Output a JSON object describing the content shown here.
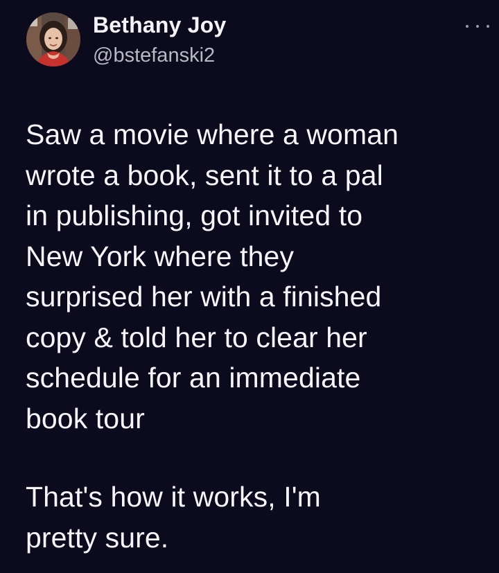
{
  "tweet": {
    "author": {
      "display_name": "Bethany Joy",
      "handle": "@bstefanski2",
      "avatar_icon": "profile-photo"
    },
    "more_icon": "more-horizontal-icon",
    "paragraphs": [
      "Saw a movie where a woman\nwrote a book, sent it to a pal\nin publishing, got invited to\nNew York where they\nsurprised her with a finished\ncopy & told her to clear her\nschedule for an immediate\nbook tour",
      "That's how it works, I'm\npretty sure."
    ]
  },
  "colors": {
    "background": "#0c0a1d",
    "text_primary": "#f6f6f8",
    "text_secondary": "#b9b9c4"
  }
}
